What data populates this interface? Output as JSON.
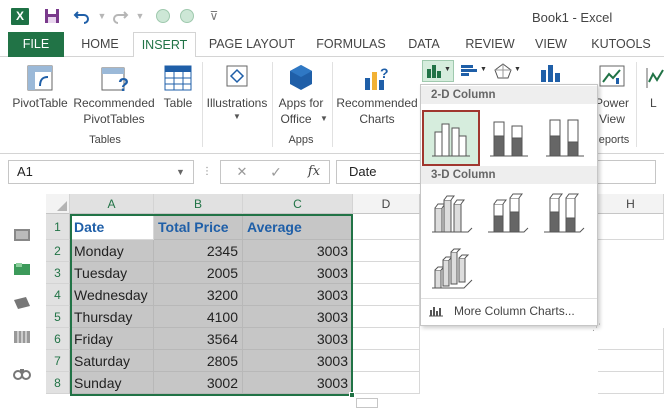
{
  "window": {
    "title": "Book1 - Excel",
    "app_logo_text": "X"
  },
  "quick_access": {
    "save": "save-icon",
    "undo": "undo-icon",
    "redo": "redo-icon"
  },
  "tabs": [
    "FILE",
    "HOME",
    "INSERT",
    "PAGE LAYOUT",
    "FORMULAS",
    "DATA",
    "REVIEW",
    "VIEW",
    "KUTOOLS"
  ],
  "ribbon": {
    "pivottable": "PivotTable",
    "recommended_pivot": [
      "Recommended",
      "PivotTables"
    ],
    "table": "Table",
    "tables_group": "Tables",
    "illustrations": "Illustrations",
    "apps_for_office": [
      "Apps for",
      "Office"
    ],
    "apps_group": "Apps",
    "recommended_charts": [
      "Recommended",
      "Charts"
    ],
    "power_view": [
      "Power",
      "View"
    ],
    "reports_group": "eports",
    "cut_label": "L"
  },
  "formula_bar": {
    "name_box": "A1",
    "cancel": "✕",
    "enter": "✓",
    "fx": "fx",
    "formula": "Date"
  },
  "sheet": {
    "columns": [
      "A",
      "B",
      "C",
      "D",
      "H"
    ],
    "rows": [
      "1",
      "2",
      "3",
      "4",
      "5",
      "6",
      "7",
      "8"
    ],
    "headers": [
      "Date",
      "Total Price",
      "Average"
    ],
    "data": [
      [
        "Monday",
        "2345",
        "3003"
      ],
      [
        "Tuesday",
        "2005",
        "3003"
      ],
      [
        "Wednesday",
        "3200",
        "3003"
      ],
      [
        "Thursday",
        "4100",
        "3003"
      ],
      [
        "Friday",
        "3564",
        "3003"
      ],
      [
        "Saturday",
        "2805",
        "3003"
      ],
      [
        "Sunday",
        "3002",
        "3003"
      ]
    ]
  },
  "chart_dropdown": {
    "section_2d": "2-D Column",
    "section_3d": "3-D Column",
    "more": "More Column Charts..."
  },
  "colors": {
    "excel_green": "#217346",
    "header_blue": "#1f5fa8",
    "selection_red": "#a0372f"
  }
}
